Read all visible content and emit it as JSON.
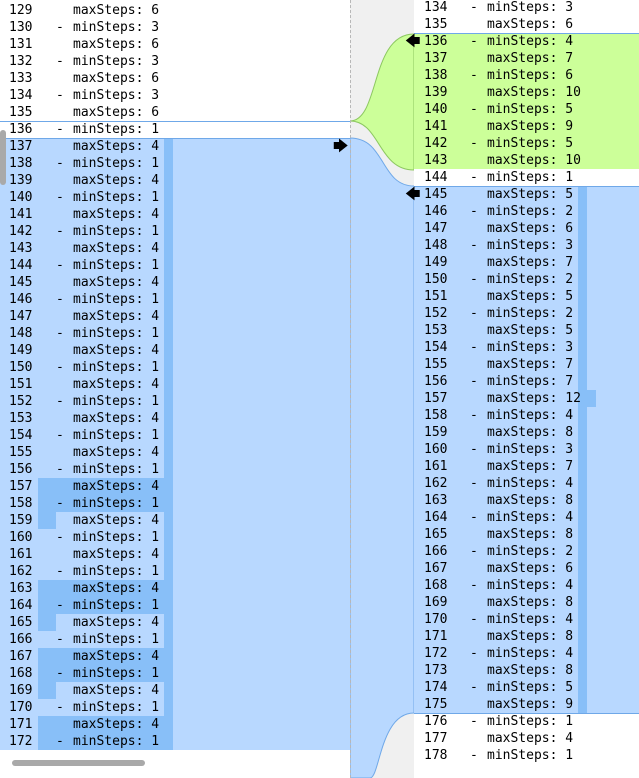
{
  "left_lines": [
    {
      "n": "129",
      "m": "",
      "t": "maxSteps: 6",
      "s": ""
    },
    {
      "n": "130",
      "m": "-",
      "t": "minSteps: 3",
      "s": ""
    },
    {
      "n": "131",
      "m": "",
      "t": "maxSteps: 6",
      "s": ""
    },
    {
      "n": "132",
      "m": "-",
      "t": "minSteps: 3",
      "s": ""
    },
    {
      "n": "133",
      "m": "",
      "t": "maxSteps: 6",
      "s": ""
    },
    {
      "n": "134",
      "m": "-",
      "t": "minSteps: 3",
      "s": ""
    },
    {
      "n": "135",
      "m": "",
      "t": "maxSteps: 6",
      "s": ""
    },
    {
      "n": "136",
      "m": "-",
      "t": "minSteps: 1",
      "s": ""
    },
    {
      "n": "137",
      "m": "",
      "t": "maxSteps: 4",
      "s": "c"
    },
    {
      "n": "138",
      "m": "-",
      "t": "minSteps: 1",
      "s": "c"
    },
    {
      "n": "139",
      "m": "",
      "t": "maxSteps: 4",
      "s": "c"
    },
    {
      "n": "140",
      "m": "-",
      "t": "minSteps: 1",
      "s": "c"
    },
    {
      "n": "141",
      "m": "",
      "t": "maxSteps: 4",
      "s": "c"
    },
    {
      "n": "142",
      "m": "-",
      "t": "minSteps: 1",
      "s": "c"
    },
    {
      "n": "143",
      "m": "",
      "t": "maxSteps: 4",
      "s": "c"
    },
    {
      "n": "144",
      "m": "-",
      "t": "minSteps: 1",
      "s": "c"
    },
    {
      "n": "145",
      "m": "",
      "t": "maxSteps: 4",
      "s": "c"
    },
    {
      "n": "146",
      "m": "-",
      "t": "minSteps: 1",
      "s": "c"
    },
    {
      "n": "147",
      "m": "",
      "t": "maxSteps: 4",
      "s": "c"
    },
    {
      "n": "148",
      "m": "-",
      "t": "minSteps: 1",
      "s": "c"
    },
    {
      "n": "149",
      "m": "",
      "t": "maxSteps: 4",
      "s": "c"
    },
    {
      "n": "150",
      "m": "-",
      "t": "minSteps: 1",
      "s": "c"
    },
    {
      "n": "151",
      "m": "",
      "t": "maxSteps: 4",
      "s": "c"
    },
    {
      "n": "152",
      "m": "-",
      "t": "minSteps: 1",
      "s": "c"
    },
    {
      "n": "153",
      "m": "",
      "t": "maxSteps: 4",
      "s": "c"
    },
    {
      "n": "154",
      "m": "-",
      "t": "minSteps: 1",
      "s": "c"
    },
    {
      "n": "155",
      "m": "",
      "t": "maxSteps: 4",
      "s": "c"
    },
    {
      "n": "156",
      "m": "-",
      "t": "minSteps: 1",
      "s": "c"
    },
    {
      "n": "157",
      "m": "",
      "t": "maxSteps: 4",
      "s": "ch"
    },
    {
      "n": "158",
      "m": "-",
      "t": "minSteps: 1",
      "s": "ch"
    },
    {
      "n": "159",
      "m": "",
      "t": "maxSteps: 4",
      "s": "cs"
    },
    {
      "n": "160",
      "m": "-",
      "t": "minSteps: 1",
      "s": "c"
    },
    {
      "n": "161",
      "m": "",
      "t": "maxSteps: 4",
      "s": "c"
    },
    {
      "n": "162",
      "m": "-",
      "t": "minSteps: 1",
      "s": "c"
    },
    {
      "n": "163",
      "m": "",
      "t": "maxSteps: 4",
      "s": "ch"
    },
    {
      "n": "164",
      "m": "-",
      "t": "minSteps: 1",
      "s": "ch"
    },
    {
      "n": "165",
      "m": "",
      "t": "maxSteps: 4",
      "s": "cs"
    },
    {
      "n": "166",
      "m": "-",
      "t": "minSteps: 1",
      "s": "c"
    },
    {
      "n": "167",
      "m": "",
      "t": "maxSteps: 4",
      "s": "ch"
    },
    {
      "n": "168",
      "m": "-",
      "t": "minSteps: 1",
      "s": "ch"
    },
    {
      "n": "169",
      "m": "",
      "t": "maxSteps: 4",
      "s": "cs"
    },
    {
      "n": "170",
      "m": "-",
      "t": "minSteps: 1",
      "s": "c"
    },
    {
      "n": "171",
      "m": "",
      "t": "maxSteps: 4",
      "s": "ch"
    },
    {
      "n": "172",
      "m": "-",
      "t": "minSteps: 1",
      "s": "ch"
    }
  ],
  "right_lines": [
    {
      "n": "134",
      "m": "-",
      "t": "minSteps: 3",
      "s": ""
    },
    {
      "n": "135",
      "m": "",
      "t": "maxSteps: 6",
      "s": ""
    },
    {
      "n": "136",
      "m": "-",
      "t": "minSteps: 4",
      "s": "a"
    },
    {
      "n": "137",
      "m": "",
      "t": "maxSteps: 7",
      "s": "a"
    },
    {
      "n": "138",
      "m": "-",
      "t": "minSteps: 6",
      "s": "a"
    },
    {
      "n": "139",
      "m": "",
      "t": "maxSteps: 10",
      "s": "a"
    },
    {
      "n": "140",
      "m": "-",
      "t": "minSteps: 5",
      "s": "a"
    },
    {
      "n": "141",
      "m": "",
      "t": "maxSteps: 9",
      "s": "a"
    },
    {
      "n": "142",
      "m": "-",
      "t": "minSteps: 5",
      "s": "a"
    },
    {
      "n": "143",
      "m": "",
      "t": "maxSteps: 10",
      "s": "a"
    },
    {
      "n": "144",
      "m": "-",
      "t": "minSteps: 1",
      "s": ""
    },
    {
      "n": "145",
      "m": "",
      "t": "maxSteps: 5",
      "s": "c"
    },
    {
      "n": "146",
      "m": "-",
      "t": "minSteps: 2",
      "s": "c"
    },
    {
      "n": "147",
      "m": "",
      "t": "maxSteps: 6",
      "s": "c"
    },
    {
      "n": "148",
      "m": "-",
      "t": "minSteps: 3",
      "s": "c"
    },
    {
      "n": "149",
      "m": "",
      "t": "maxSteps: 7",
      "s": "c"
    },
    {
      "n": "150",
      "m": "-",
      "t": "minSteps: 2",
      "s": "c"
    },
    {
      "n": "151",
      "m": "",
      "t": "maxSteps: 5",
      "s": "c"
    },
    {
      "n": "152",
      "m": "-",
      "t": "minSteps: 2",
      "s": "c"
    },
    {
      "n": "153",
      "m": "",
      "t": "maxSteps: 5",
      "s": "c"
    },
    {
      "n": "154",
      "m": "-",
      "t": "minSteps: 3",
      "s": "c"
    },
    {
      "n": "155",
      "m": "",
      "t": "maxSteps: 7",
      "s": "c"
    },
    {
      "n": "156",
      "m": "-",
      "t": "minSteps: 7",
      "s": "c"
    },
    {
      "n": "157",
      "m": "",
      "t": "maxSteps: 12",
      "s": "c"
    },
    {
      "n": "158",
      "m": "-",
      "t": "minSteps: 4",
      "s": "c"
    },
    {
      "n": "159",
      "m": "",
      "t": "maxSteps: 8",
      "s": "c"
    },
    {
      "n": "160",
      "m": "-",
      "t": "minSteps: 3",
      "s": "c"
    },
    {
      "n": "161",
      "m": "",
      "t": "maxSteps: 7",
      "s": "c"
    },
    {
      "n": "162",
      "m": "-",
      "t": "minSteps: 4",
      "s": "c"
    },
    {
      "n": "163",
      "m": "",
      "t": "maxSteps: 8",
      "s": "c"
    },
    {
      "n": "164",
      "m": "-",
      "t": "minSteps: 4",
      "s": "c"
    },
    {
      "n": "165",
      "m": "",
      "t": "maxSteps: 8",
      "s": "c"
    },
    {
      "n": "166",
      "m": "-",
      "t": "minSteps: 2",
      "s": "c"
    },
    {
      "n": "167",
      "m": "",
      "t": "maxSteps: 6",
      "s": "c"
    },
    {
      "n": "168",
      "m": "-",
      "t": "minSteps: 4",
      "s": "c"
    },
    {
      "n": "169",
      "m": "",
      "t": "maxSteps: 8",
      "s": "c"
    },
    {
      "n": "170",
      "m": "-",
      "t": "minSteps: 4",
      "s": "c"
    },
    {
      "n": "171",
      "m": "",
      "t": "maxSteps: 8",
      "s": "c"
    },
    {
      "n": "172",
      "m": "-",
      "t": "minSteps: 4",
      "s": "c"
    },
    {
      "n": "173",
      "m": "",
      "t": "maxSteps: 8",
      "s": "c"
    },
    {
      "n": "174",
      "m": "-",
      "t": "minSteps: 5",
      "s": "c"
    },
    {
      "n": "175",
      "m": "",
      "t": "maxSteps: 9",
      "s": "c"
    },
    {
      "n": "176",
      "m": "-",
      "t": "minSteps: 1",
      "s": ""
    },
    {
      "n": "177",
      "m": "",
      "t": "maxSteps: 4",
      "s": ""
    },
    {
      "n": "178",
      "m": "-",
      "t": "minSteps: 1",
      "s": ""
    }
  ],
  "colors": {
    "added": "#ccff99",
    "changed": "#b8d8ff",
    "intraline": "#88bff8",
    "gutter": "#f0f0f0"
  },
  "icons": {
    "copy_right": "arrow-right-icon",
    "copy_left": "arrow-left-icon"
  }
}
